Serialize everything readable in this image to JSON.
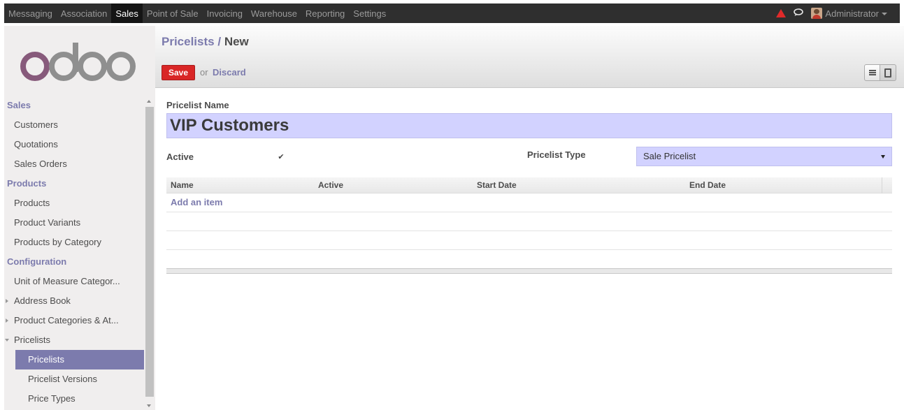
{
  "topbar": {
    "menu": [
      "Messaging",
      "Association",
      "Sales",
      "Point of Sale",
      "Invoicing",
      "Warehouse",
      "Reporting",
      "Settings"
    ],
    "active": "Sales",
    "user": "Administrator"
  },
  "sidebar": {
    "logo": "odoo",
    "sections": [
      {
        "title": "Sales",
        "items": [
          "Customers",
          "Quotations",
          "Sales Orders"
        ]
      },
      {
        "title": "Products",
        "items": [
          "Products",
          "Product Variants",
          "Products by Category"
        ]
      },
      {
        "title": "Configuration",
        "items": [
          "Unit of Measure Categor...",
          "Address Book",
          "Product Categories & At...",
          "Pricelists"
        ]
      }
    ],
    "pricelist_subitems": [
      "Pricelists",
      "Pricelist Versions",
      "Price Types"
    ],
    "active_item": "Pricelists"
  },
  "control_panel": {
    "breadcrumb_parent": "Pricelists",
    "breadcrumb_sep": "/",
    "breadcrumb_current": "New",
    "save_label": "Save",
    "or_label": "or",
    "discard_label": "Discard"
  },
  "form": {
    "name_label": "Pricelist Name",
    "name_value": "VIP Customers",
    "active_label": "Active",
    "active_checked": true,
    "active_mark": "✔",
    "type_label": "Pricelist Type",
    "type_value": "Sale Pricelist",
    "table": {
      "columns": [
        "Name",
        "Active",
        "Start Date",
        "End Date"
      ],
      "add_item_label": "Add an item"
    }
  },
  "colors": {
    "accent": "#7c7bad",
    "save_button": "#d92626",
    "input_bg": "#d2d2ff",
    "topbar_bg": "#2f2f2f",
    "warning_icon": "#e02a2a"
  }
}
